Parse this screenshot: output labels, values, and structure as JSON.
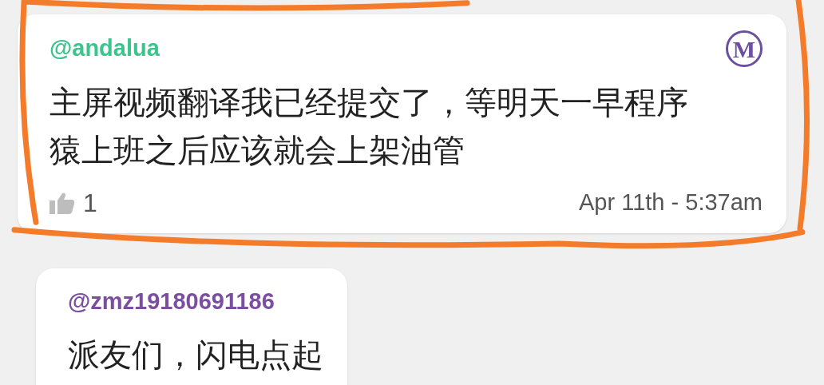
{
  "messages": [
    {
      "author": "@andalua",
      "color": "#3cc48e",
      "badge": "M",
      "text": "主屏视频翻译我已经提交了，等明天一早程序猿上班之后应该就会上架油管",
      "likes": "1",
      "time": "Apr 11th - 5:37am",
      "highlighted": true
    },
    {
      "author": "@zmz19180691186",
      "color": "#7b4fa0",
      "text": "派友们，闪电点起",
      "highlighted": false
    }
  ]
}
